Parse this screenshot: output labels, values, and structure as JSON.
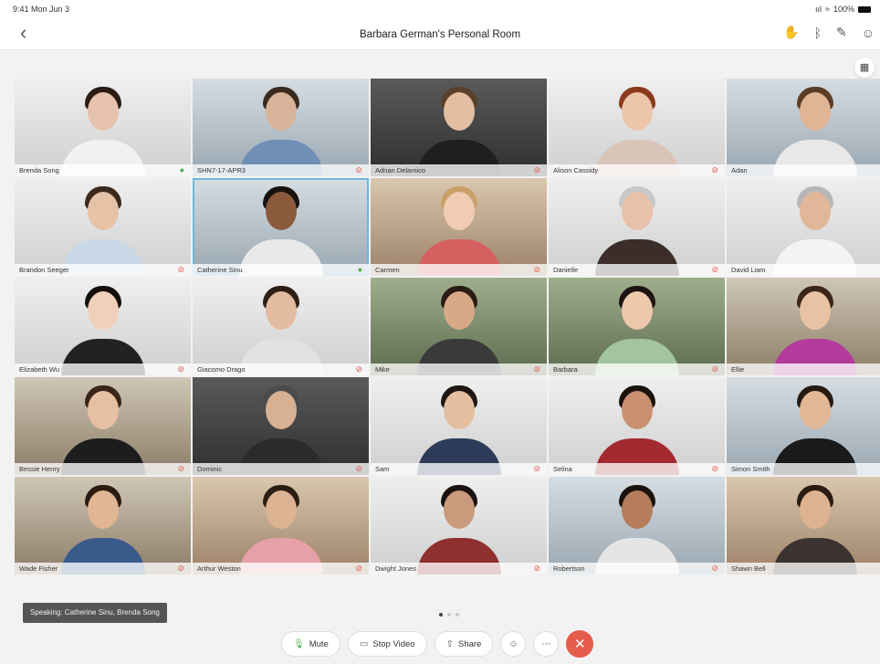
{
  "status_bar": {
    "time": "9:41  Mon Jun 3",
    "signal": "ııl",
    "wifi": "≈",
    "battery": "100%"
  },
  "nav": {
    "title": "Barbara German's Personal Room",
    "icons": [
      "back-icon",
      "hand-raise-icon",
      "bluetooth-icon",
      "annotate-icon",
      "participants-icon"
    ]
  },
  "participants": [
    {
      "name": "Brenda Song",
      "mic": "on",
      "skin": "#e7c3ad",
      "hair": "#2a1c14",
      "shirt": "#f1f1f1",
      "bg": "bg-light"
    },
    {
      "name": "SHN7-17-APR3",
      "mic": "muted",
      "skin": "#d8b49a",
      "hair": "#3a2a20",
      "shirt": "#6f8fb5",
      "bg": "bg-cool",
      "device": true
    },
    {
      "name": "Adrian Delamico",
      "mic": "muted",
      "skin": "#e3bea2",
      "hair": "#5a402b",
      "shirt": "#1f1f1f",
      "bg": "bg-dark"
    },
    {
      "name": "Alison Cassidy",
      "mic": "muted",
      "skin": "#ecc6ab",
      "hair": "#8a3b1b",
      "shirt": "#d9c5b8",
      "bg": "bg-light"
    },
    {
      "name": "Adan",
      "mic": "muted",
      "skin": "#e0b595",
      "hair": "#5b3d26",
      "shirt": "#e8e8e8",
      "bg": "bg-cool"
    },
    {
      "name": "Brandon Seeger",
      "mic": "muted",
      "skin": "#e6c2a6",
      "hair": "#3b2a1c",
      "shirt": "#c9d8e6",
      "bg": "bg-light"
    },
    {
      "name": "Catherine Sinu",
      "mic": "on",
      "skin": "#8b5a3c",
      "hair": "#1a120d",
      "shirt": "#e9e9e9",
      "bg": "bg-cool",
      "active": true
    },
    {
      "name": "Carmen",
      "mic": "muted",
      "skin": "#f0cdb2",
      "hair": "#c9a06a",
      "shirt": "#d6605f",
      "bg": "bg-warm"
    },
    {
      "name": "Danielle",
      "mic": "muted",
      "skin": "#e7c1a8",
      "hair": "#c8c8c8",
      "shirt": "#3a2d2a",
      "bg": "bg-light"
    },
    {
      "name": "David Liam",
      "mic": "muted",
      "skin": "#e1b79a",
      "hair": "#b7b7b7",
      "shirt": "#f3f3f3",
      "bg": "bg-light"
    },
    {
      "name": "Elizabeth Wu",
      "mic": "muted",
      "skin": "#f0d0bb",
      "hair": "#150f0c",
      "shirt": "#222222",
      "bg": "bg-light"
    },
    {
      "name": "Giacomo Drago",
      "mic": "muted",
      "skin": "#e3bba0",
      "hair": "#2d1f16",
      "shirt": "#e2e2e2",
      "bg": "bg-light"
    },
    {
      "name": "Mike",
      "mic": "muted",
      "skin": "#d7a988",
      "hair": "#2b1d14",
      "shirt": "#3a3a3a",
      "bg": "bg-green"
    },
    {
      "name": "Barbara",
      "mic": "muted",
      "skin": "#ecc8ad",
      "hair": "#1d1411",
      "shirt": "#a2c4a1",
      "bg": "bg-green"
    },
    {
      "name": "Ellie",
      "mic": "muted",
      "skin": "#e9c2a4",
      "hair": "#3b2618",
      "shirt": "#b23b9c",
      "bg": "bg-office"
    },
    {
      "name": "Bessie Henry",
      "mic": "muted",
      "skin": "#e6c0a2",
      "hair": "#3a2519",
      "shirt": "#1d1d1d",
      "bg": "bg-office"
    },
    {
      "name": "Dominic",
      "mic": "muted",
      "skin": "#d8b092",
      "hair": "#4b4b4b",
      "shirt": "#2b2b2b",
      "bg": "bg-dark"
    },
    {
      "name": "Sam",
      "mic": "muted",
      "skin": "#e3bf9f",
      "hair": "#1e1714",
      "shirt": "#2c3b5a",
      "bg": "bg-light"
    },
    {
      "name": "Selina",
      "mic": "muted",
      "skin": "#c99172",
      "hair": "#1b120e",
      "shirt": "#a32a2f",
      "bg": "bg-light"
    },
    {
      "name": "Simon Smith",
      "mic": "muted",
      "skin": "#e2b896",
      "hair": "#261a12",
      "shirt": "#1a1a1a",
      "bg": "bg-cool"
    },
    {
      "name": "Wade Fisher",
      "mic": "muted",
      "skin": "#e0b695",
      "hair": "#2b1b12",
      "shirt": "#3a5a8c",
      "bg": "bg-office"
    },
    {
      "name": "Arthur Weston",
      "mic": "muted",
      "skin": "#dcb393",
      "hair": "#2b1e15",
      "shirt": "#e5a0a8",
      "bg": "bg-warm"
    },
    {
      "name": "Dwight Jones",
      "mic": "muted",
      "skin": "#c99a7b",
      "hair": "#1a120e",
      "shirt": "#8f2f2f",
      "bg": "bg-light"
    },
    {
      "name": "Robertson",
      "mic": "muted",
      "skin": "#b57d5b",
      "hair": "#1a120c",
      "shirt": "#e5e5e5",
      "bg": "bg-cool"
    },
    {
      "name": "Shawn Bell",
      "mic": "muted",
      "skin": "#ddb391",
      "hair": "#2a1c12",
      "shirt": "#3a3330",
      "bg": "bg-warm"
    }
  ],
  "speaking": "Speaking: Catherine Sinu, Brenda Song",
  "pagination": {
    "pages": 3,
    "current": 1
  },
  "controls": {
    "mute_label": "Mute",
    "stop_video_label": "Stop Video",
    "share_label": "Share"
  },
  "colors": {
    "active_border": "#6cb8da",
    "end_call": "#e55b4c",
    "mic_on": "#4bb04b",
    "mic_muted": "#e0594f"
  }
}
